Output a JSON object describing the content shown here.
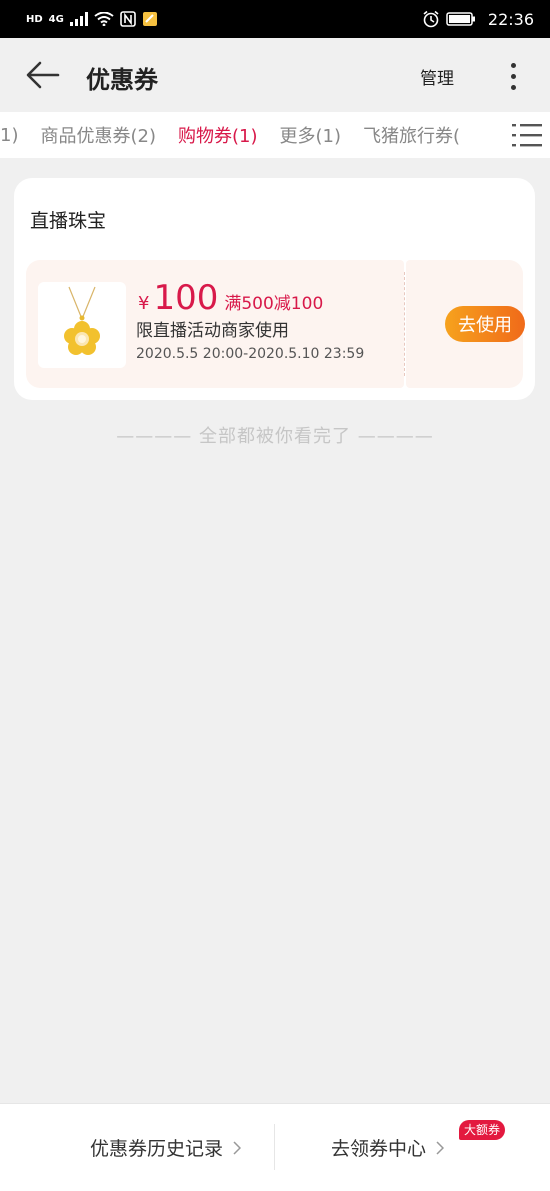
{
  "status_bar": {
    "hd": "HD",
    "network": "4G",
    "time": "22:36",
    "icons": [
      "signal-icon",
      "wifi-icon",
      "nfc-icon",
      "notes-icon",
      "alarm-icon",
      "battery-icon"
    ]
  },
  "header": {
    "title": "优惠券",
    "manage_label": "管理",
    "back_icon": "arrow-left-icon",
    "more_icon": "more-vertical-icon"
  },
  "tabs": {
    "items": [
      {
        "label": "1)"
      },
      {
        "label": "商品优惠券(2)"
      },
      {
        "label": "购物券(1)"
      },
      {
        "label": "更多(1)"
      },
      {
        "label": "飞猪旅行券("
      }
    ],
    "active_index": 2,
    "menu_icon": "list-menu-icon"
  },
  "card": {
    "shop_name": "直播珠宝",
    "coupon": {
      "currency": "¥",
      "amount": "100",
      "condition": "满500减100",
      "description": "限直播活动商家使用",
      "validity": "2020.5.5 20:00-2020.5.10 23:59",
      "use_label": "去使用",
      "image_icon": "flower-pendant-icon"
    }
  },
  "end_text": "———— 全部都被你看完了 ————",
  "bottom_bar": {
    "history_label": "优惠券历史记录",
    "center_label": "去领券中心",
    "badge": "大额券"
  },
  "colors": {
    "accent": "#d8194a",
    "button_gradient_start": "#f6a21d",
    "button_gradient_end": "#f06a1a",
    "coupon_bg": "#fdf4f0",
    "page_bg": "#f0f0f0"
  }
}
